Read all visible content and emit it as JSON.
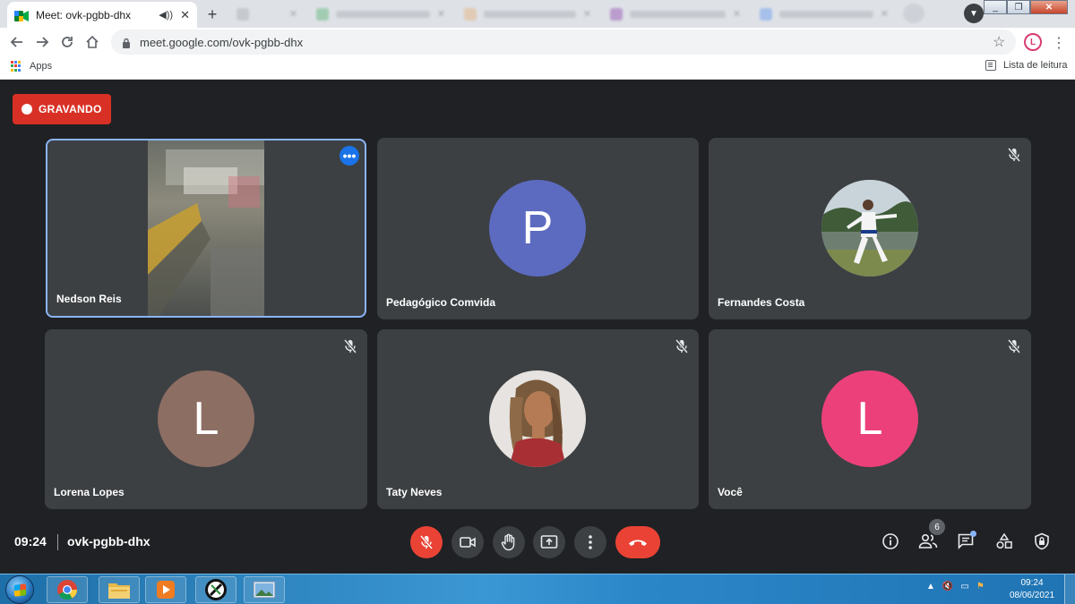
{
  "browser": {
    "active_tab": {
      "title": "Meet: ovk-pgbb-dhx",
      "icon": "google-meet-icon",
      "audio_icon": "speaker-icon",
      "close_icon": "close-icon"
    },
    "new_tab_icon": "plus-icon",
    "url": "meet.google.com/ovk-pgbb-dhx",
    "profile_initial": "L",
    "bookmarks": {
      "apps_label": "Apps",
      "reading_list_label": "Lista de leitura"
    }
  },
  "meet": {
    "recording_label": "GRAVANDO",
    "participants": [
      {
        "name": "Nedson Reis",
        "type": "video",
        "muted": false
      },
      {
        "name": "Pedagógico Comvida",
        "type": "letter",
        "initial": "P",
        "color": "#5c6bc0",
        "muted": false
      },
      {
        "name": "Fernandes Costa",
        "type": "photo",
        "muted": true
      },
      {
        "name": "Lorena Lopes",
        "type": "letter",
        "initial": "L",
        "color": "#8d6e63",
        "muted": true
      },
      {
        "name": "Taty Neves",
        "type": "photo",
        "muted": true
      },
      {
        "name": "Você",
        "type": "letter",
        "initial": "L",
        "color": "#ec407a",
        "muted": true
      }
    ],
    "bottom_bar": {
      "time": "09:24",
      "meeting_code": "ovk-pgbb-dhx",
      "participant_count": "6"
    }
  },
  "taskbar": {
    "time": "09:24",
    "date": "08/06/2021"
  }
}
